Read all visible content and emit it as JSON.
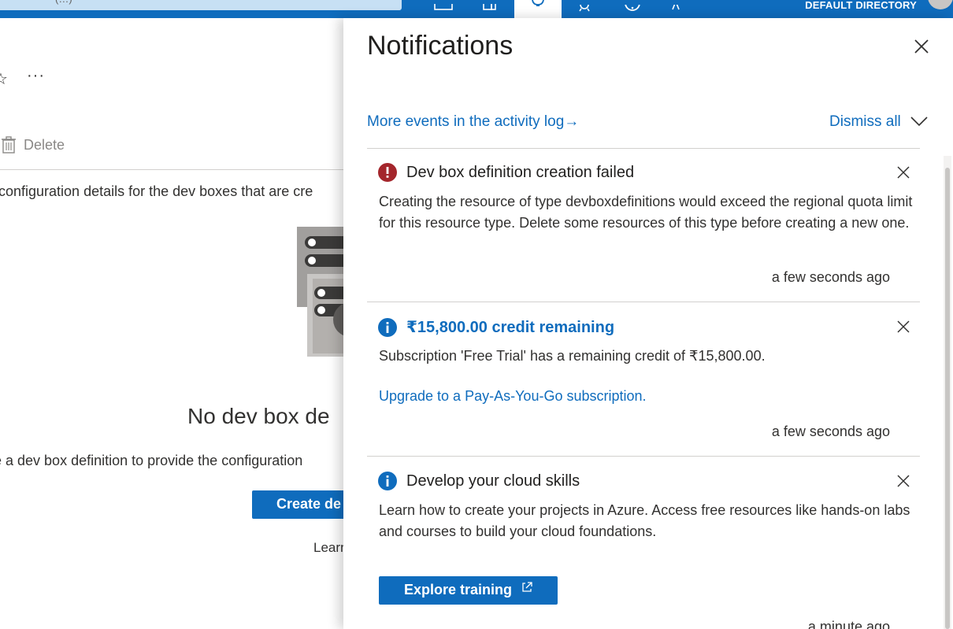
{
  "topbar": {
    "directory": "DEFAULT DIRECTORY",
    "search_text": "(…)",
    "icons": [
      "cloud-shell-icon",
      "directory-filter-icon",
      "notifications-bell-icon",
      "settings-gear-icon",
      "help-icon",
      "feedback-icon",
      "avatar"
    ],
    "accent_color": "#0f6cbd"
  },
  "background_page": {
    "toolbar": {
      "more_label": "···",
      "delete_label": "Delete"
    },
    "description": "configuration details for the dev boxes that are cre",
    "empty_state": {
      "title": "No dev box de",
      "subtitle": "e a dev box definition to provide the configuration",
      "create_button": "Create de",
      "learn_text": "Learn"
    }
  },
  "notifications": {
    "title": "Notifications",
    "activity_log_link": "More events in the activity log",
    "activity_arrow": "→",
    "dismiss_all": "Dismiss all",
    "items": [
      {
        "icon": "error-icon",
        "title": "Dev box definition creation failed",
        "body": "Creating the resource of type devboxdefinitions would exceed the regional quota limit for this resource type. Delete some resources of this type before creating a new one.",
        "time": "a few seconds ago",
        "status_color": "#a4262c"
      },
      {
        "icon": "info-icon",
        "title": "₹15,800.00 credit remaining",
        "body": "Subscription 'Free Trial' has a remaining credit of ₹15,800.00.",
        "link": "Upgrade to a Pay-As-You-Go subscription.",
        "time": "a few seconds ago",
        "status_color": "#0f6cbd"
      },
      {
        "icon": "info-icon",
        "title": "Develop your cloud skills",
        "body": "Learn how to create your projects in Azure. Access free resources like hands-on labs and courses to build your cloud foundations.",
        "button": "Explore training",
        "time": "a minute ago",
        "status_color": "#0f6cbd"
      }
    ]
  }
}
